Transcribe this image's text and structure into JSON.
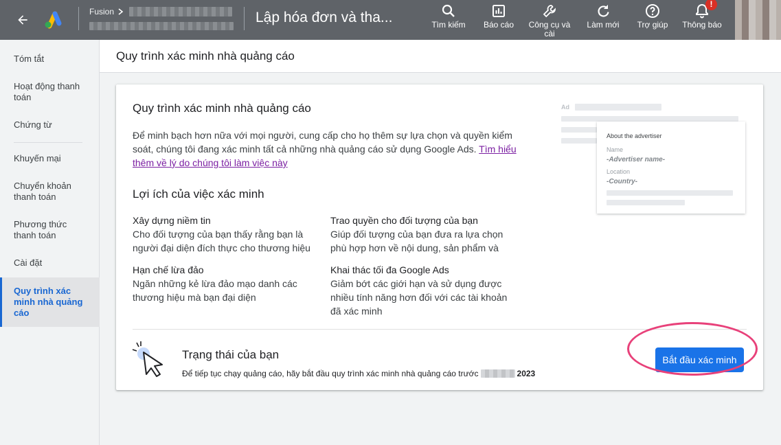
{
  "topbar": {
    "account_name": "Fusion",
    "page_title": "Lập hóa đơn và tha...",
    "tools": [
      {
        "label": "Tìm kiếm",
        "icon": "search-icon"
      },
      {
        "label": "Báo cáo",
        "icon": "reports-icon"
      },
      {
        "label": "Công cụ và cài",
        "icon": "wrench-icon"
      },
      {
        "label": "Làm mới",
        "icon": "refresh-icon"
      },
      {
        "label": "Trợ giúp",
        "icon": "help-icon"
      },
      {
        "label": "Thông báo",
        "icon": "bell-icon",
        "badge": "!"
      }
    ]
  },
  "sidebar": {
    "items": [
      {
        "label": "Tóm tắt"
      },
      {
        "label": "Hoạt động thanh toán"
      },
      {
        "label": "Chứng từ"
      },
      {
        "label": "Khuyến mại"
      },
      {
        "label": "Chuyển khoản thanh toán"
      },
      {
        "label": "Phương thức thanh toán"
      },
      {
        "label": "Cài đặt"
      },
      {
        "label": "Quy trình xác minh nhà quảng cáo",
        "active": true
      }
    ]
  },
  "header": {
    "title": "Quy trình xác minh nhà quảng cáo"
  },
  "card": {
    "title": "Quy trình xác minh nhà quảng cáo",
    "intro": "Để minh bạch hơn nữa với mọi người, cung cấp cho họ thêm sự lựa chọn và quyền kiểm soát, chúng tôi đang xác minh tất cả những nhà quảng cáo sử dụng Google Ads. ",
    "intro_link": "Tìm hiểu thêm về lý do chúng tôi làm việc này",
    "benefits_title": "Lợi ích của việc xác minh",
    "benefits": [
      {
        "title": "Xây dựng niềm tin",
        "desc": "Cho đối tượng của bạn thấy rằng bạn là người đại diện đích thực cho thương hiệu của mình"
      },
      {
        "title": "Trao quyền cho đối tượng của bạn",
        "desc": "Giúp đối tượng của bạn đưa ra lựa chọn phù hợp hơn về nội dung, sản phẩm và dịch vụ mà họ sử dụng"
      },
      {
        "title": "Hạn chế lừa đảo",
        "desc": "Ngăn những kẻ lừa đảo mạo danh các thương hiệu mà bạn đại diện"
      },
      {
        "title": "Khai thác tối đa Google Ads",
        "desc": "Giảm bớt các giới hạn và sử dụng được nhiều tính năng hơn đối với các tài khoản đã xác minh"
      }
    ],
    "illustration": {
      "ad_label": "Ad",
      "heading": "About the advertiser",
      "name_label": "Name",
      "name_value": "-Advertiser name-",
      "location_label": "Location",
      "location_value": "-Country-"
    },
    "status": {
      "title": "Trạng thái của bạn",
      "desc": "Để tiếp tục chạy quảng cáo, hãy bắt đầu quy trình xác minh nhà quảng cáo trước",
      "year": "2023",
      "button": "Bắt đầu xác minh"
    }
  },
  "colors": {
    "topbar": "#5f6368",
    "primary": "#1a73e8",
    "highlight": "#e8417a",
    "link": "#7b1fa2"
  }
}
